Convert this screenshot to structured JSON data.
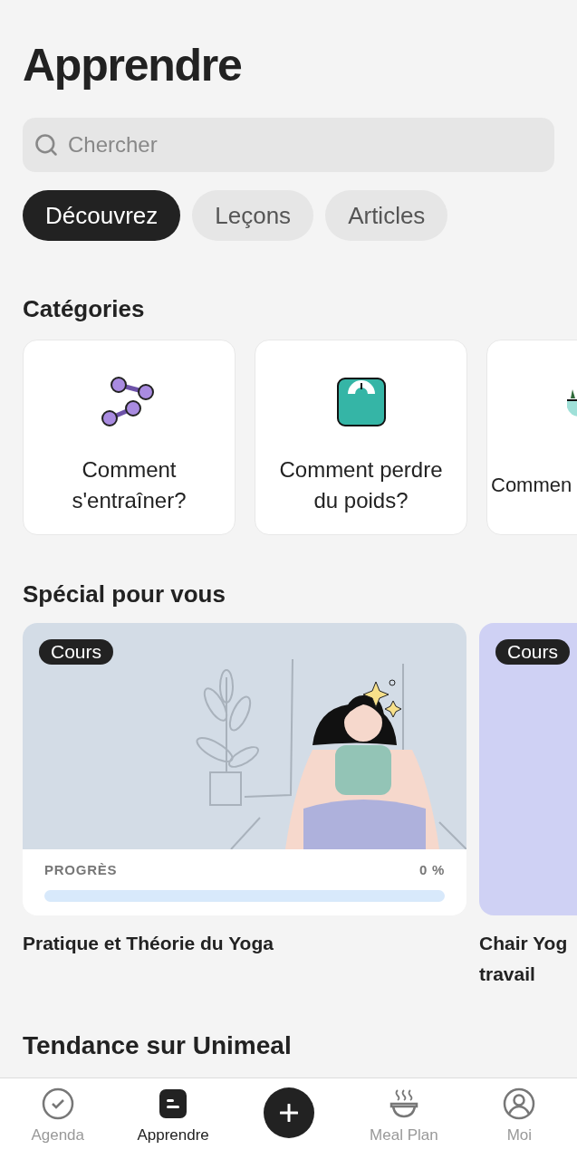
{
  "title": "Apprendre",
  "search": {
    "placeholder": "Chercher"
  },
  "tabs": [
    {
      "label": "Découvrez",
      "selected": true
    },
    {
      "label": "Leçons",
      "selected": false
    },
    {
      "label": "Articles",
      "selected": false
    }
  ],
  "categories": {
    "heading": "Catégories",
    "items": [
      {
        "kind": "dumbbells",
        "lines": [
          "Comment",
          "s'entraîner?"
        ]
      },
      {
        "kind": "scale",
        "lines": [
          "Comment perdre",
          "du poids?"
        ]
      },
      {
        "kind": "bowl",
        "lines": [
          "Commen"
        ]
      }
    ]
  },
  "special": {
    "heading": "Spécial pour vous",
    "courses": [
      {
        "badge": "Cours",
        "kind": "picture",
        "progress_label": "PROGRÈS",
        "progress_value": "0 %",
        "level": 0,
        "title_lines": [
          "Pratique et Théorie du Yoga"
        ]
      },
      {
        "badge": "Cours",
        "kind": "plain",
        "title_lines": [
          "Chair Yog",
          "travail"
        ]
      }
    ]
  },
  "trending": {
    "heading": "Tendance sur Unimeal"
  },
  "nav": [
    {
      "label": "Agenda",
      "kind": "check",
      "selected": false
    },
    {
      "label": "Apprendre",
      "kind": "learn",
      "selected": true
    },
    {
      "kind": "add"
    },
    {
      "label": "Meal Plan",
      "kind": "bowl",
      "selected": false
    },
    {
      "label": "Moi",
      "kind": "user",
      "selected": false
    }
  ]
}
